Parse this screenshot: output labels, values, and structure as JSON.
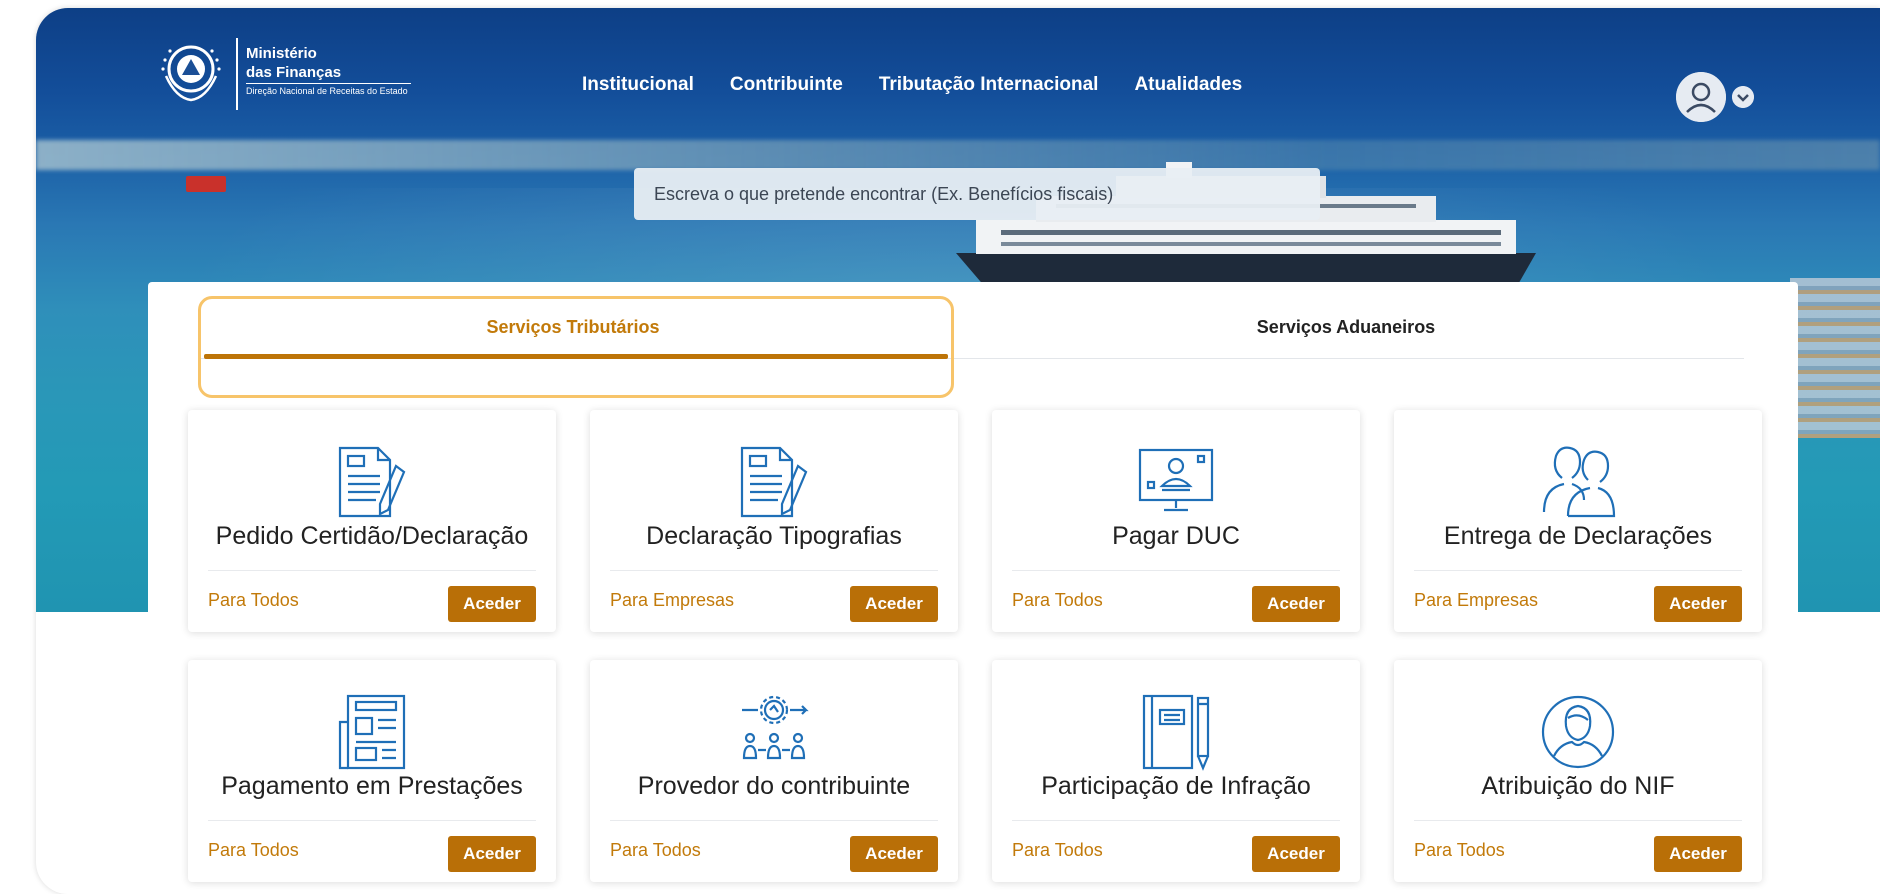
{
  "brand": {
    "line1": "Ministério",
    "line2": "das Finanças",
    "line3": "Direção Nacional de Receitas do Estado"
  },
  "nav": {
    "items": [
      {
        "label": "Institucional"
      },
      {
        "label": "Contribuinte"
      },
      {
        "label": "Tributação Internacional"
      },
      {
        "label": "Atualidades"
      }
    ]
  },
  "user": {
    "avatar_icon": "user-icon",
    "menu_icon": "chevron-down-icon"
  },
  "search": {
    "placeholder": "Escreva o que pretende encontrar (Ex. Benefícios fiscais)"
  },
  "tabs": [
    {
      "label": "Serviços Tributários",
      "active": true
    },
    {
      "label": "Serviços Aduaneiros",
      "active": false
    }
  ],
  "cards": [
    {
      "title": "Pedido Certidão/Declaração",
      "audience": "Para Todos",
      "button": "Aceder",
      "icon": "document-pen-icon"
    },
    {
      "title": "Declaração Tipografias",
      "audience": "Para Empresas",
      "button": "Aceder",
      "icon": "document-pen-icon"
    },
    {
      "title": "Pagar DUC",
      "audience": "Para Todos",
      "button": "Aceder",
      "icon": "monitor-user-icon"
    },
    {
      "title": "Entrega de Declarações",
      "audience": "Para Empresas",
      "button": "Aceder",
      "icon": "people-icon"
    },
    {
      "title": "Pagamento em Prestações",
      "audience": "Para Todos",
      "button": "Aceder",
      "icon": "newspaper-icon"
    },
    {
      "title": "Provedor do contribuinte",
      "audience": "Para Todos",
      "button": "Aceder",
      "icon": "network-gear-icon"
    },
    {
      "title": "Participação de Infração",
      "audience": "Para Todos",
      "button": "Aceder",
      "icon": "notebook-pen-icon"
    },
    {
      "title": "Atribuição do NIF",
      "audience": "Para Todos",
      "button": "Aceder",
      "icon": "user-circle-icon"
    }
  ],
  "colors": {
    "accent": "#c27a0a",
    "button": "#b96f07",
    "icon": "#1f6fb7",
    "highlight": "#f7c46a"
  }
}
